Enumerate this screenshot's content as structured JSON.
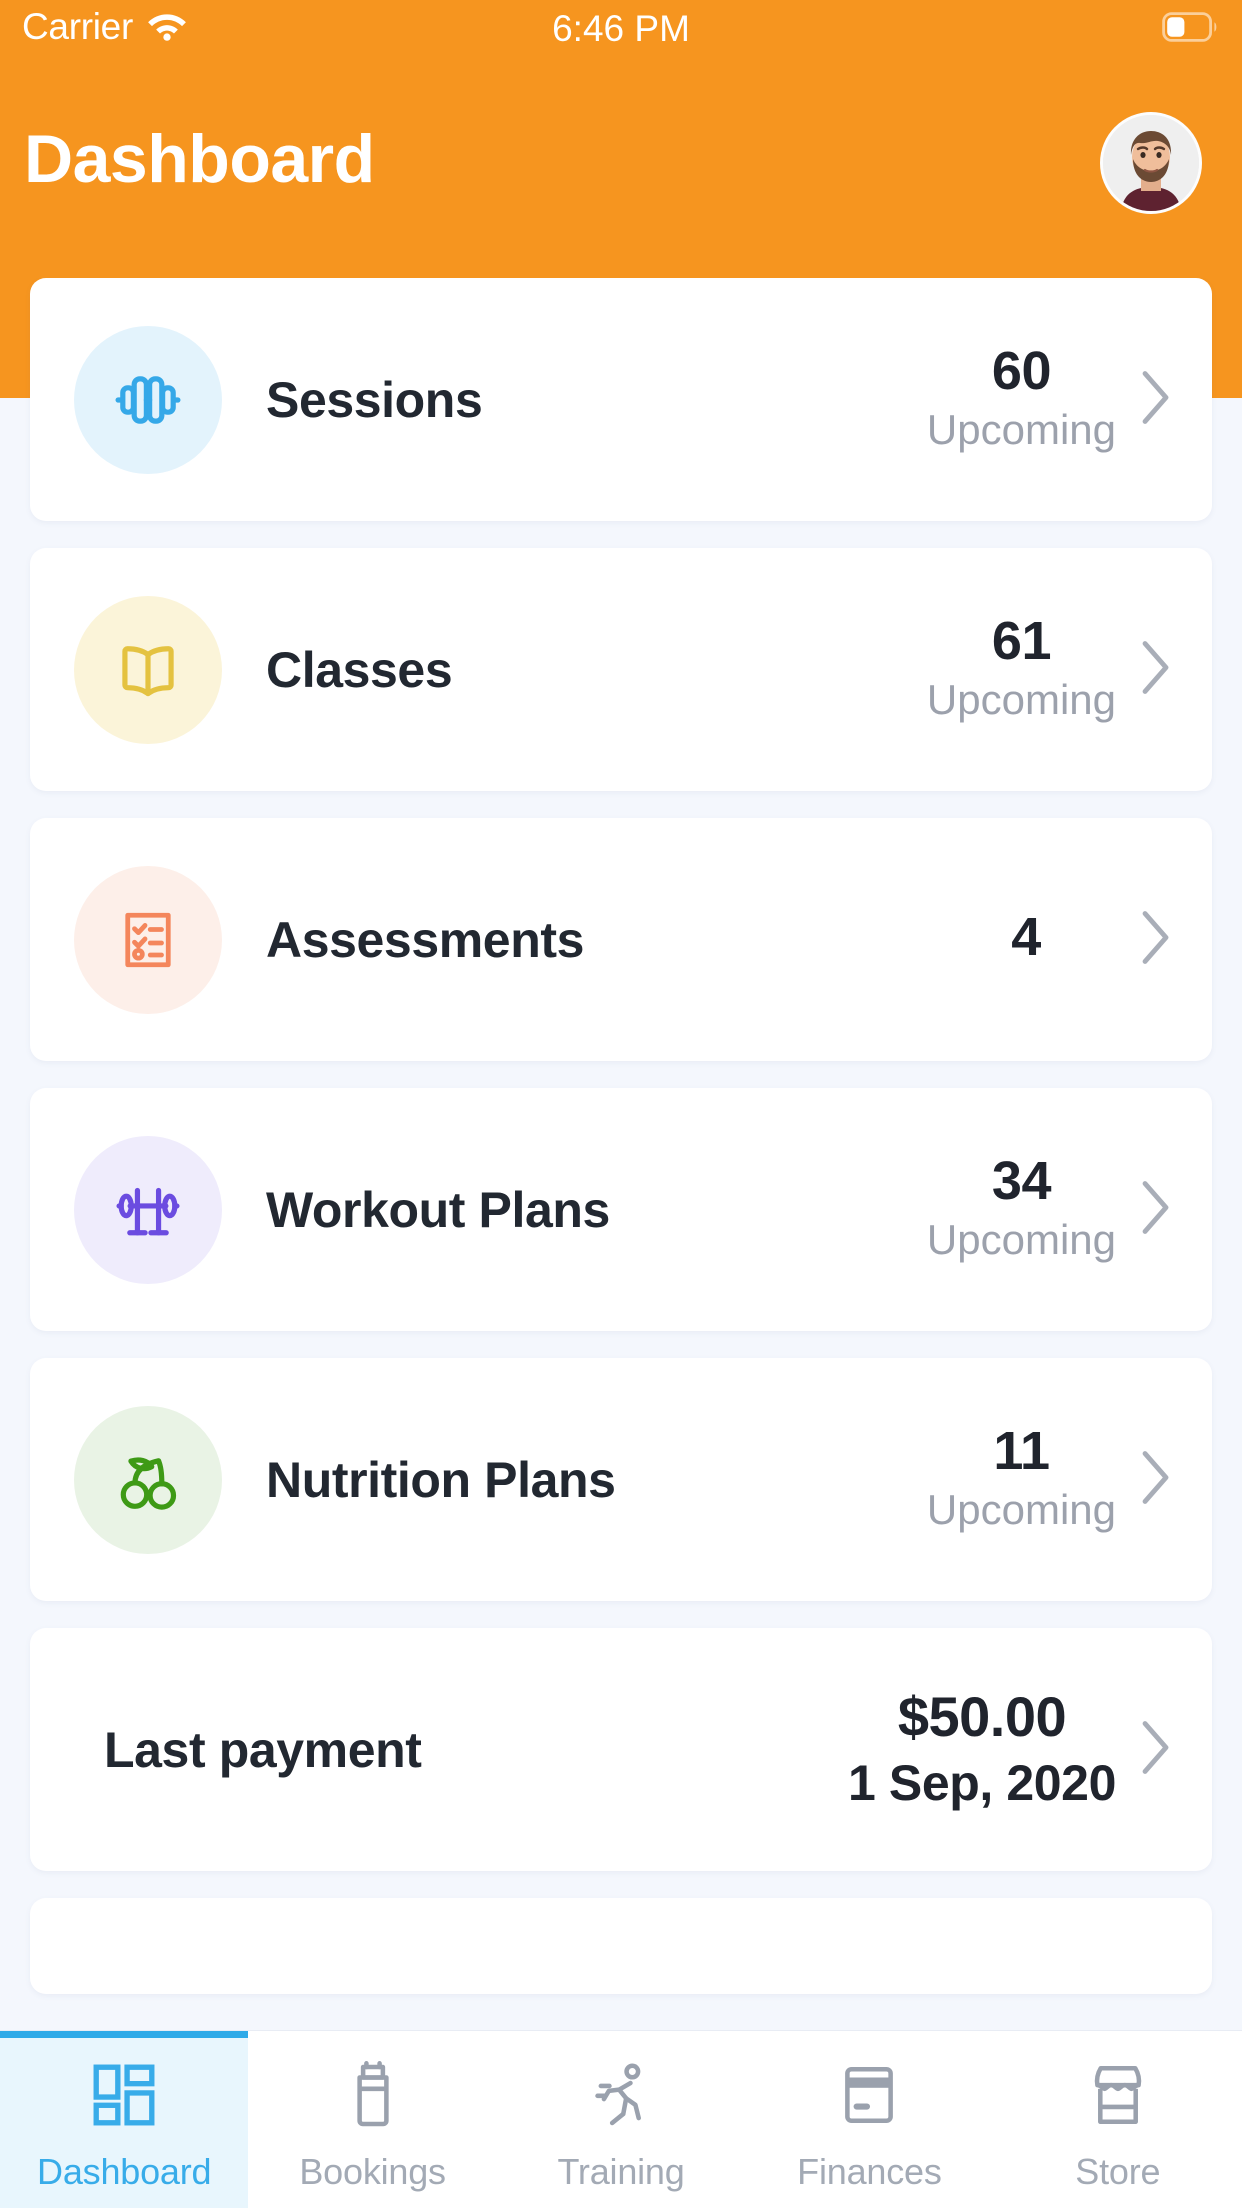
{
  "status_bar": {
    "carrier": "Carrier",
    "time": "6:46 PM",
    "wifi_icon": "wifi-icon",
    "battery_icon": "battery-icon"
  },
  "header": {
    "title": "Dashboard",
    "avatar_icon": "user-avatar",
    "background_color": "#F6951F"
  },
  "cards": [
    {
      "icon": "dumbbell-icon",
      "label": "Sessions",
      "value": "60",
      "sub": "Upcoming",
      "icon_color": "#35A8E8",
      "icon_bg": "#E3F3FC"
    },
    {
      "icon": "open-book-icon",
      "label": "Classes",
      "value": "61",
      "sub": "Upcoming",
      "icon_color": "#E4C240",
      "icon_bg": "#FBF4D9"
    },
    {
      "icon": "checklist-icon",
      "label": "Assessments",
      "value": "4",
      "sub": "",
      "icon_color": "#F4865C",
      "icon_bg": "#FDEFE9"
    },
    {
      "icon": "barbell-rack-icon",
      "label": "Workout Plans",
      "value": "34",
      "sub": "Upcoming",
      "icon_color": "#6B4CE0",
      "icon_bg": "#EFECFC"
    },
    {
      "icon": "cherries-icon",
      "label": "Nutrition Plans",
      "value": "11",
      "sub": "Upcoming",
      "icon_color": "#3E9A16",
      "icon_bg": "#E9F3E5"
    }
  ],
  "payment": {
    "label": "Last payment",
    "amount": "$50.00",
    "date": "1 Sep, 2020"
  },
  "tabs": [
    {
      "label": "Dashboard",
      "icon": "grid-dashboard-icon",
      "active": true
    },
    {
      "label": "Bookings",
      "icon": "water-bottle-icon",
      "active": false
    },
    {
      "label": "Training",
      "icon": "running-person-icon",
      "active": false
    },
    {
      "label": "Finances",
      "icon": "credit-card-icon",
      "active": false
    },
    {
      "label": "Store",
      "icon": "storefront-icon",
      "active": false
    }
  ],
  "colors": {
    "accent_orange": "#F6951F",
    "accent_blue": "#38ACE9",
    "page_bg": "#F4F7FD",
    "text_dark": "#20242D",
    "text_muted": "#9CA1AC"
  }
}
